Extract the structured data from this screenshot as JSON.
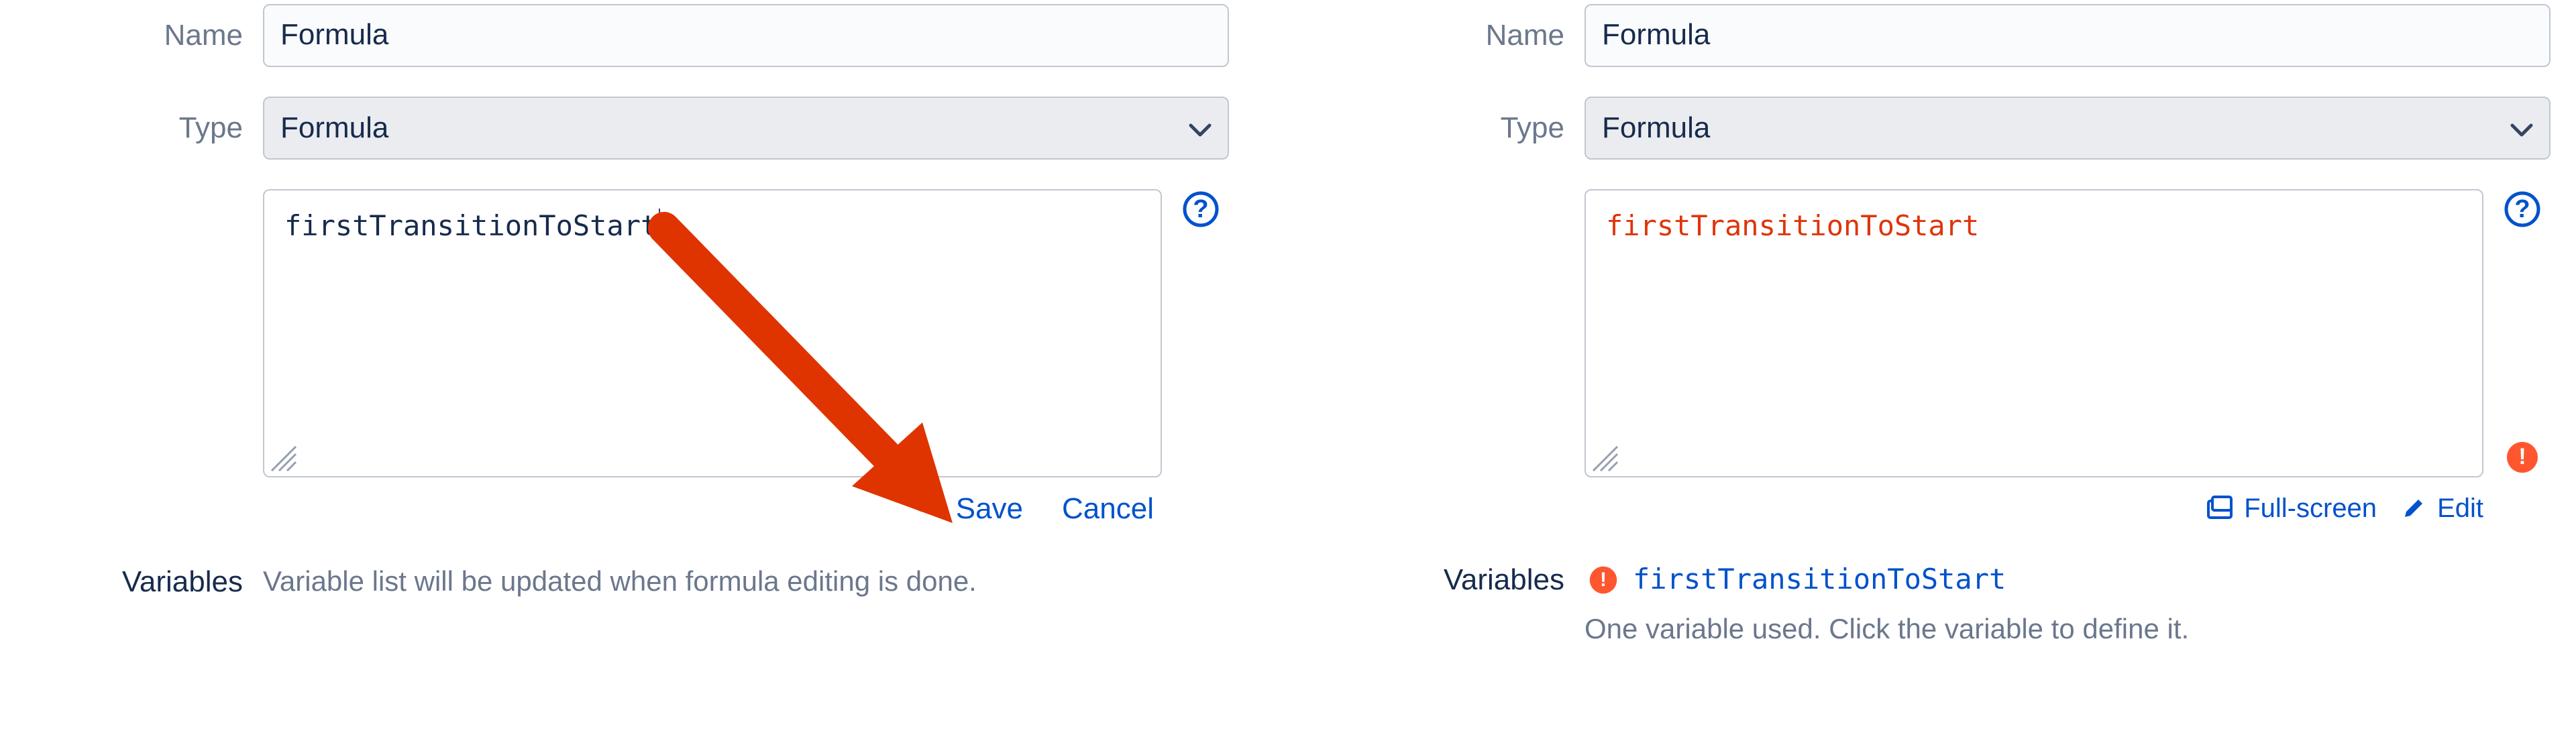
{
  "left": {
    "labels": {
      "name": "Name",
      "type": "Type",
      "variables": "Variables"
    },
    "name_value": "Formula",
    "type_value": "Formula",
    "formula_code": "firstTransitionToStart",
    "actions": {
      "save": "Save",
      "cancel": "Cancel"
    },
    "variables_help": "Variable list will be updated when formula editing is done."
  },
  "right": {
    "labels": {
      "name": "Name",
      "type": "Type",
      "variables": "Variables"
    },
    "name_value": "Formula",
    "type_value": "Formula",
    "formula_code": "firstTransitionToStart",
    "edit_actions": {
      "fullscreen": "Full-screen",
      "edit": "Edit"
    },
    "variable_link": "firstTransitionToStart",
    "variables_sub": "One variable used. Click the variable to define it."
  }
}
